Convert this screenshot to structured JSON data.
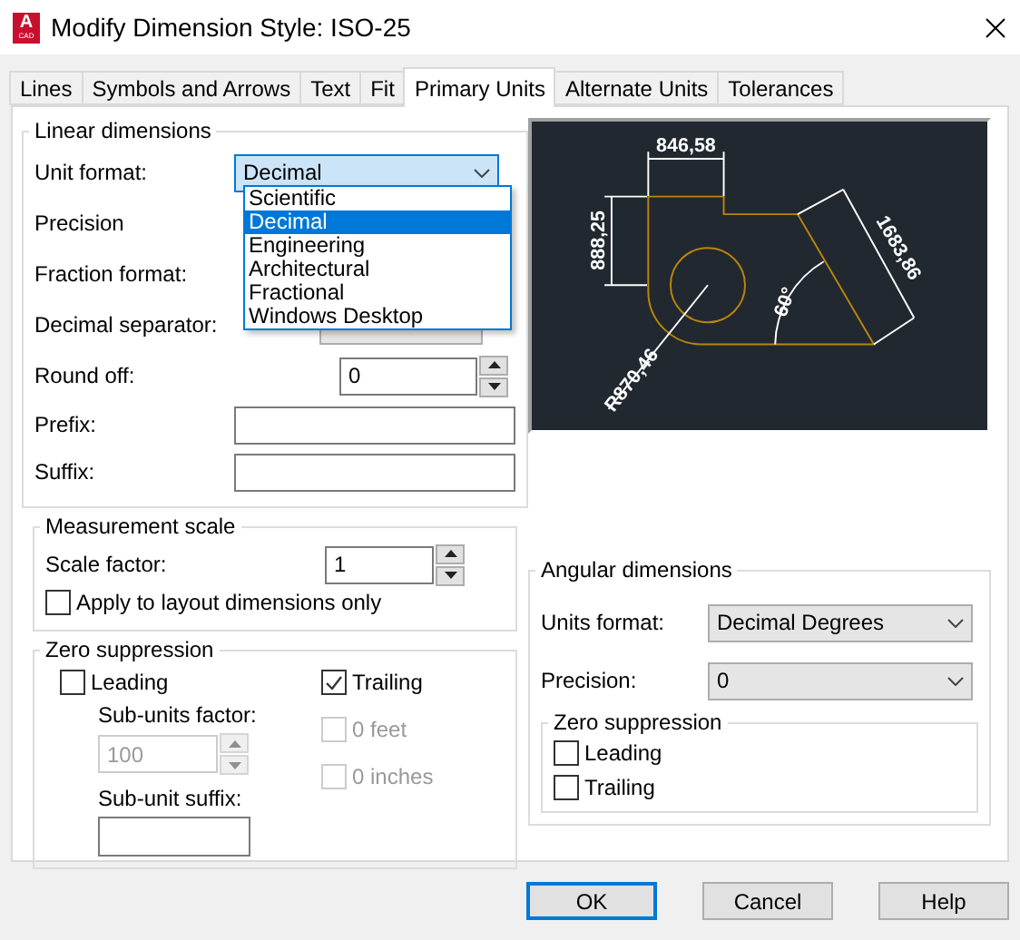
{
  "window": {
    "title": "Modify Dimension Style: ISO-25",
    "logo": "A",
    "logo_sub": "CAD"
  },
  "tabs": [
    {
      "label": "Lines",
      "selected": false
    },
    {
      "label": "Symbols and Arrows",
      "selected": false
    },
    {
      "label": "Text",
      "selected": false
    },
    {
      "label": "Fit",
      "selected": false
    },
    {
      "label": "Primary Units",
      "selected": true
    },
    {
      "label": "Alternate Units",
      "selected": false
    },
    {
      "label": "Tolerances",
      "selected": false
    }
  ],
  "linear": {
    "title": "Linear dimensions",
    "fields": [
      {
        "kind": "combo",
        "label": "Unit format:",
        "value": "Decimal"
      },
      {
        "kind": "covered",
        "label": "Precision"
      },
      {
        "kind": "covered",
        "label": "Fraction format:"
      },
      {
        "kind": "partial",
        "label": "Decimal separator:"
      },
      {
        "kind": "spin",
        "label": "Round off:",
        "value": "0"
      },
      {
        "kind": "text",
        "label": "Prefix:"
      },
      {
        "kind": "text",
        "label": "Suffix:"
      }
    ],
    "dropdown": [
      {
        "label": "Scientific",
        "selected": false
      },
      {
        "label": "Decimal",
        "selected": true
      },
      {
        "label": "Engineering",
        "selected": false
      },
      {
        "label": "Architectural",
        "selected": false
      },
      {
        "label": "Fractional",
        "selected": false
      },
      {
        "label": "Windows Desktop",
        "selected": false
      }
    ]
  },
  "measurement_scale": {
    "title": "Measurement scale",
    "scale_label": "Scale factor:",
    "scale_value": "1",
    "apply": {
      "label": "Apply to layout dimensions only",
      "checked": false
    }
  },
  "zero_suppression": {
    "title": "Zero suppression",
    "leading": {
      "label": "Leading",
      "checked": false
    },
    "sub_units_factor": {
      "label": "Sub-units factor:",
      "value": "100",
      "disabled": true
    },
    "sub_unit_suffix": {
      "label": "Sub-unit suffix:"
    },
    "trailing": {
      "label": "Trailing",
      "checked": true,
      "disabled": false
    },
    "feet": {
      "label": "0 feet",
      "checked": false,
      "disabled": true
    },
    "inches": {
      "label": "0 inches",
      "checked": false,
      "disabled": true
    }
  },
  "preview": {
    "labels": [
      "846,58",
      "888,25",
      "1683,86",
      "60°",
      "R870,46"
    ]
  },
  "angular": {
    "title": "Angular dimensions",
    "units_label": "Units format:",
    "units_value": "Decimal Degrees",
    "precision_label": "Precision:",
    "precision_value": "0",
    "zero_suppression": {
      "title": "Zero suppression",
      "options": [
        {
          "label": "Leading",
          "checked": false
        },
        {
          "label": "Trailing",
          "checked": false
        }
      ]
    }
  },
  "buttons": [
    {
      "label": "OK",
      "default": true
    },
    {
      "label": "Cancel",
      "default": false
    },
    {
      "label": "Help",
      "default": false
    }
  ]
}
